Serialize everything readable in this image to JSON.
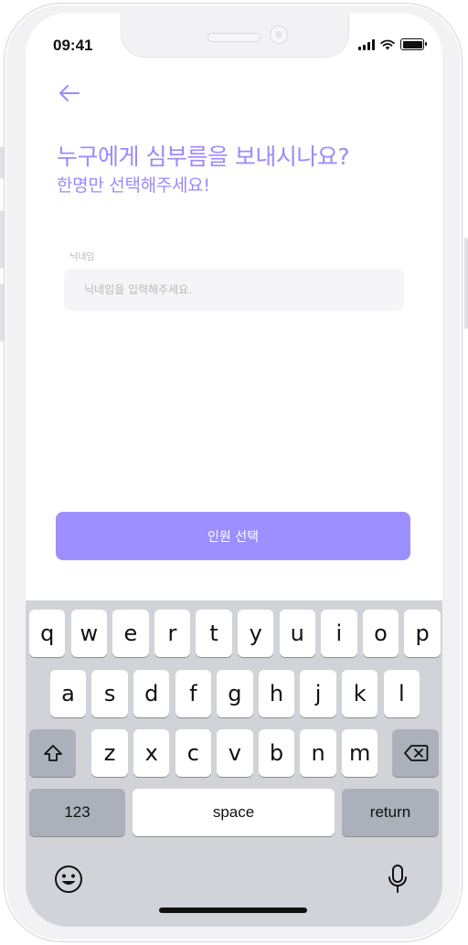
{
  "status_bar": {
    "time": "09:41"
  },
  "header": {
    "back_icon": "arrow-left-icon",
    "title_line1": "누구에게 심부름을 보내시나요?",
    "title_line2": "한명만 선택해주세요!"
  },
  "nickname_field": {
    "label": "닉네임",
    "placeholder": "닉네임을 입력해주세요.",
    "value": ""
  },
  "select_button": {
    "label": "인원 선택"
  },
  "keyboard": {
    "row1": [
      "q",
      "w",
      "e",
      "r",
      "t",
      "y",
      "u",
      "i",
      "o",
      "p"
    ],
    "row2": [
      "a",
      "s",
      "d",
      "f",
      "g",
      "h",
      "j",
      "k",
      "l"
    ],
    "row3": [
      "z",
      "x",
      "c",
      "v",
      "b",
      "n",
      "m"
    ],
    "numbers_label": "123",
    "space_label": "space",
    "return_label": "return",
    "shift_icon": "shift-icon",
    "backspace_icon": "backspace-icon",
    "emoji_icon": "emoji-icon",
    "mic_icon": "microphone-icon"
  },
  "colors": {
    "accent": "#9b8aff",
    "button": "#9d8fff",
    "input_bg": "#f5f5f7",
    "keyboard_bg": "#d1d3d9",
    "key_dark": "#abb0ba"
  }
}
